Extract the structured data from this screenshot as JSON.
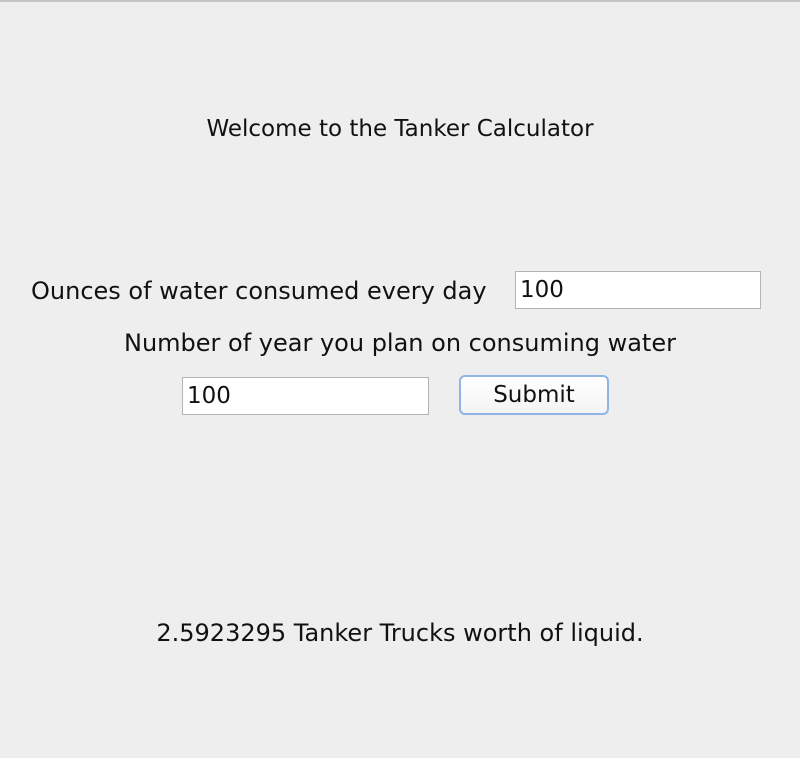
{
  "title": "Welcome to the Tanker Calculator",
  "ounces": {
    "label": "Ounces of water consumed every day",
    "value": "100"
  },
  "years": {
    "label": "Number of year you plan on consuming water",
    "value": "100"
  },
  "submit": {
    "label": "Submit"
  },
  "result": {
    "text": "2.5923295 Tanker Trucks worth of liquid."
  }
}
